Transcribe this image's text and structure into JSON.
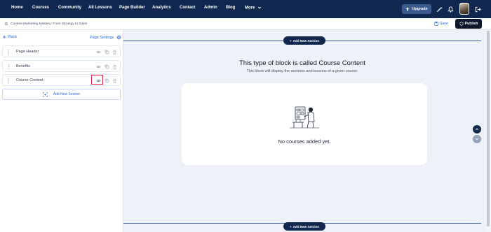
{
  "nav": {
    "items": [
      "Home",
      "Courses",
      "Community",
      "All Lessons",
      "Page Builder",
      "Analytics",
      "Contact",
      "Admin",
      "Blog",
      "More"
    ],
    "upgrade_label": "Upgrade",
    "colors": {
      "bar": "#10284f",
      "accent": "#2563eb"
    }
  },
  "subbar": {
    "breadcrumb": "Content Marketing Mastery: From Strategy to Sales",
    "save_label": "Save",
    "publish_label": "Publish"
  },
  "sidebar": {
    "back_label": "Back",
    "page_settings_label": "Page Settings",
    "sections": [
      {
        "label": "Page Header"
      },
      {
        "label": "Benefits"
      },
      {
        "label": "Course Content"
      }
    ],
    "add_section_label": "Add New Section"
  },
  "canvas": {
    "add_section_top": "Add New Section",
    "add_section_bottom": "Add New Section",
    "block_title": "This type of block is called Course Content",
    "block_subtitle": "This block will display the sections and lessons of a given course.",
    "empty_message": "No courses added yet."
  }
}
